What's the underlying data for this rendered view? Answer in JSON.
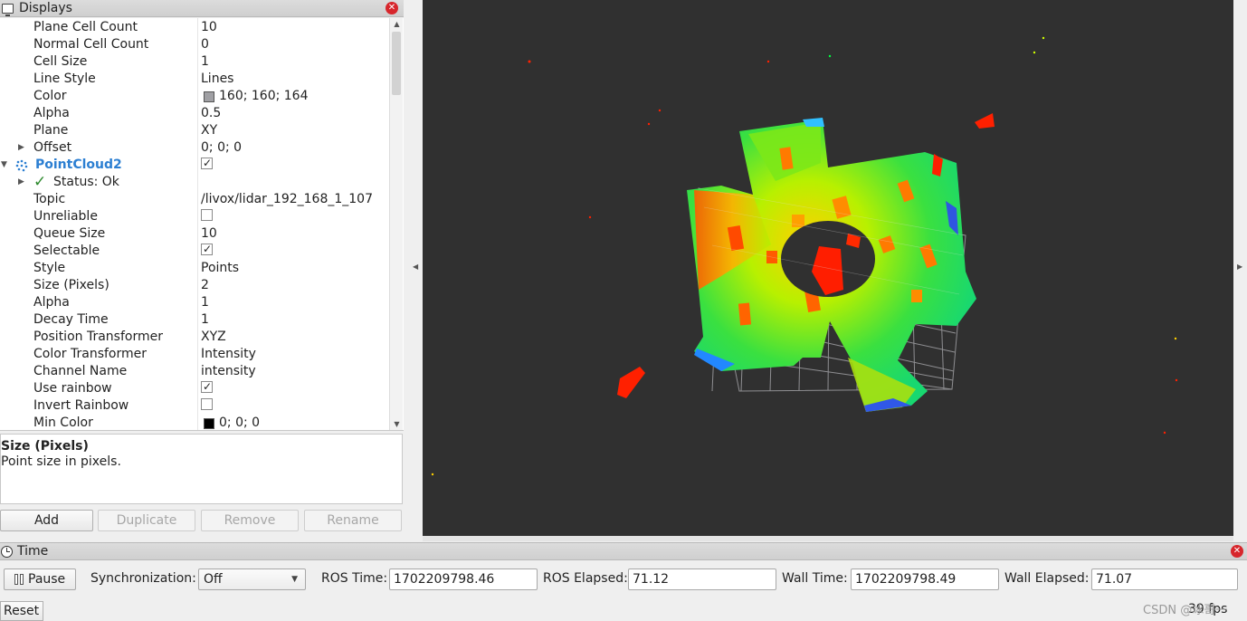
{
  "displays": {
    "title": "Displays",
    "rows": [
      {
        "label": "Plane Cell Count",
        "value": "10"
      },
      {
        "label": "Normal Cell Count",
        "value": "0"
      },
      {
        "label": "Cell Size",
        "value": "1"
      },
      {
        "label": "Line Style",
        "value": "Lines"
      },
      {
        "label": "Color",
        "value": "160; 160; 164",
        "swatch": "#a0a0a4"
      },
      {
        "label": "Alpha",
        "value": "0.5"
      },
      {
        "label": "Plane",
        "value": "XY"
      },
      {
        "label": "Offset",
        "value": "0; 0; 0"
      },
      {
        "label": "PointCloud2",
        "checked": true
      },
      {
        "label": "Status: Ok"
      },
      {
        "label": "Topic",
        "value": "/livox/lidar_192_168_1_107"
      },
      {
        "label": "Unreliable",
        "checked": false
      },
      {
        "label": "Queue Size",
        "value": "10"
      },
      {
        "label": "Selectable",
        "checked": true
      },
      {
        "label": "Style",
        "value": "Points"
      },
      {
        "label": "Size (Pixels)",
        "value": "2"
      },
      {
        "label": "Alpha",
        "value": "1"
      },
      {
        "label": "Decay Time",
        "value": "1"
      },
      {
        "label": "Position Transformer",
        "value": "XYZ"
      },
      {
        "label": "Color Transformer",
        "value": "Intensity"
      },
      {
        "label": "Channel Name",
        "value": "intensity"
      },
      {
        "label": "Use rainbow",
        "checked": true
      },
      {
        "label": "Invert Rainbow",
        "checked": false
      },
      {
        "label": "Min Color",
        "value": "0; 0; 0",
        "swatch": "#000000"
      }
    ],
    "description": {
      "title": "Size (Pixels)",
      "text": "Point size in pixels."
    },
    "buttons": {
      "add": "Add",
      "duplicate": "Duplicate",
      "remove": "Remove",
      "rename": "Rename"
    }
  },
  "time": {
    "title": "Time",
    "pause_label": "Pause",
    "sync_label": "Synchronization:",
    "sync_value": "Off",
    "ros_time_label": "ROS Time:",
    "ros_time": "1702209798.46",
    "ros_elapsed_label": "ROS Elapsed:",
    "ros_elapsed": "71.12",
    "wall_time_label": "Wall Time:",
    "wall_time": "1702209798.49",
    "wall_elapsed_label": "Wall Elapsed:",
    "wall_elapsed": "71.07",
    "reset_label": "Reset",
    "fps": "39 fps",
    "watermark": "CSDN @冰哥一"
  },
  "colors": {
    "view_background": "#303030",
    "grid": "#a0a0a4",
    "accent_blue": "#2c7fd2",
    "close_red": "#d7262c"
  }
}
